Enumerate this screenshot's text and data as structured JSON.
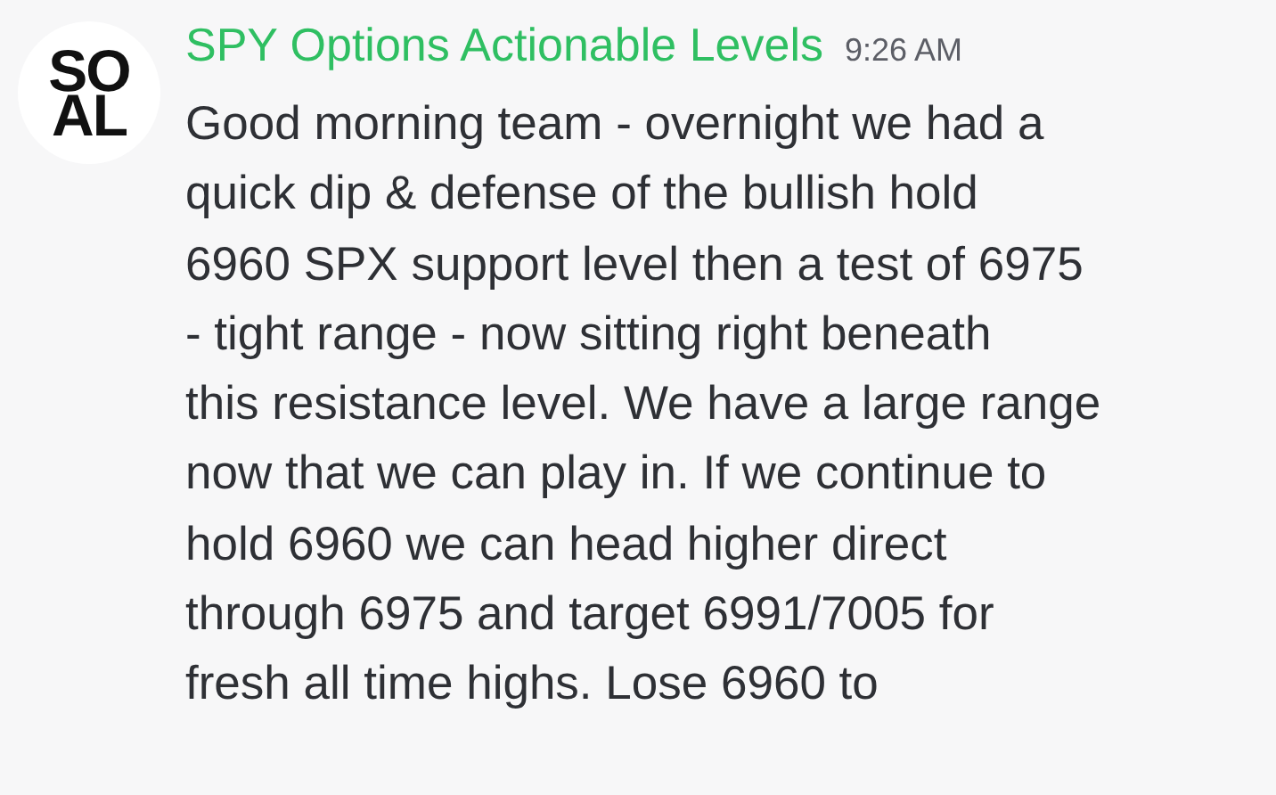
{
  "message": {
    "avatar": {
      "logo": [
        "SO",
        "AL"
      ]
    },
    "author": "SPY Options Actionable Levels",
    "time": "9:26 AM",
    "lines": [
      "Good morning team - overnight we had a",
      "quick dip & defense of the bullish hold",
      "6960 SPX support level then a test of 6975",
      "- tight range - now sitting right beneath",
      "this resistance level.  We have a large range",
      "now that we can play in. If we continue to",
      "hold 6960 we can head higher direct",
      "through 6975 and target 6991/7005 for",
      "fresh all time highs. Lose 6960 to"
    ]
  }
}
